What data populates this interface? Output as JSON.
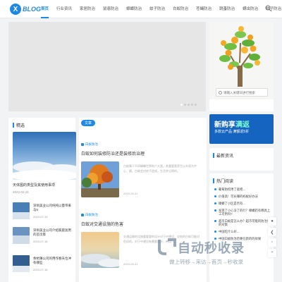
{
  "logo": {
    "mark": "X",
    "text": "BLOG"
  },
  "nav": [
    "首页",
    "行业资讯",
    "家居防治",
    "鼠患防治",
    "蟑螂防治",
    "蚊子防治",
    "白蚁防治",
    "苍蝇防治",
    "跳蚤防治",
    "螨虫防治",
    "蚊子防治"
  ],
  "search": {
    "placeholder": "请输入关键词进行搜索"
  },
  "left": {
    "title": "精选",
    "feature": {
      "title": "天体图的类型及其使用事项",
      "date": "2022-02-21"
    },
    "items": [
      {
        "title": "深圳美业公司纯纯以量带来与5",
        "date": "2023-07-19"
      },
      {
        "title": "深圳美业公司介绍家庭饭用的首页策",
        "date": "2023-07-18"
      },
      {
        "title": "余杭镇公司的用作春天位冲有哪些",
        "date": "2023-07-16"
      }
    ]
  },
  "mid": {
    "badge": "文章",
    "posts": [
      {
        "category": "白蚁防治",
        "title": "白蚁如何装修防治还是装修后治理",
        "excerpt": "白蚁属于不同蟑螂世界的六大类，其重要营养生以木质为中心，随，白蚁会对房子造成，生活并记得的。",
        "date": "2023-05-31"
      },
      {
        "category": "白蚁防治",
        "title": "白蚁对交通设施的危害",
        "excerpt": "交通运输的设施重要要的设计对于中建设，交结的白蚁可能对危机的。对于中建设有需要设计，带用...",
        "date": "2023-05-31"
      }
    ]
  },
  "promo": {
    "title_a": "新购享",
    "title_b": "满返",
    "sub": "多款云产品 满额返5折"
  },
  "latest": {
    "title": "最新资讯"
  },
  "hot": {
    "title": "热门阅读",
    "items": [
      "葡萄防控用了就把...",
      "价值高！可长赚的蚂蚁好办法",
      "蟑螂了小区是否有...",
      "发现了小心没了的行？蟑螂药有哪具上工可用吗?",
      "超市白蚁是怎么办？超市可能的防治要的对策",
      "中国吃什么好...",
      "中国白蚁防治后要在新的的效果"
    ]
  },
  "watermark": {
    "main": "自动秒收录",
    "sub": "做上转移→来访→首页→秒收录"
  },
  "colors": {
    "accent": "#1e88e5",
    "promo": "#1565c0"
  }
}
